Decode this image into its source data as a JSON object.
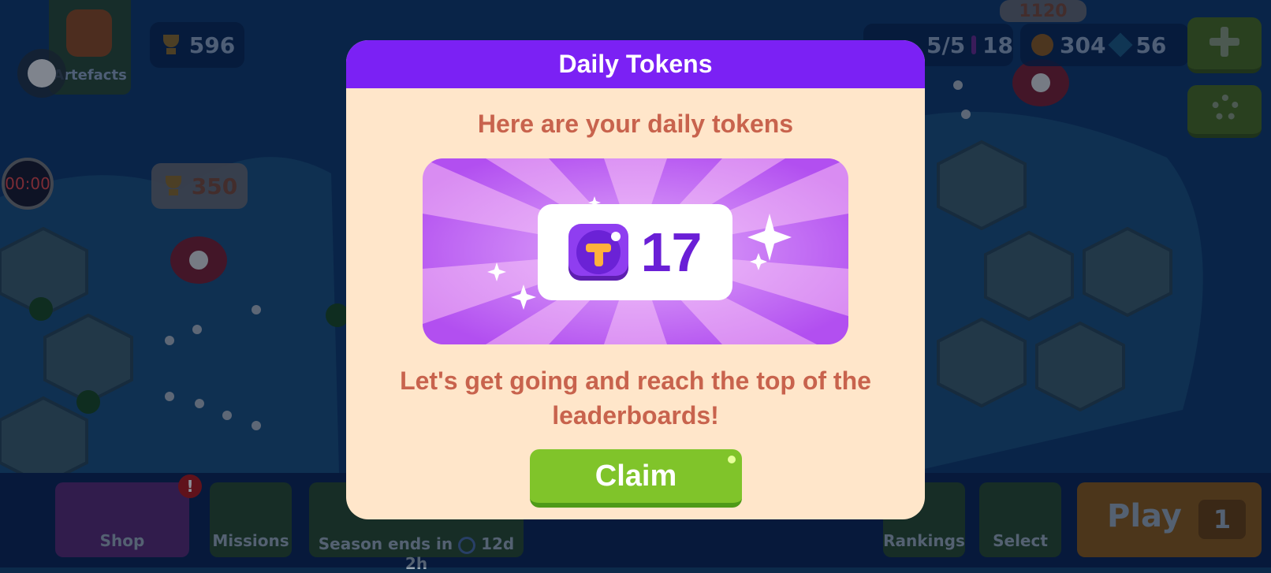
{
  "hud": {
    "artefacts_label": "Artefacts",
    "timer": "00:00",
    "trophies_main": "596",
    "trophies_marker": "350",
    "trophies_top": "1120",
    "lives": "5/5",
    "tokens_hud": "18",
    "coins": "304",
    "gems": "56"
  },
  "bottom_nav": {
    "shop": "Shop",
    "missions": "Missions",
    "season": "Season ends in",
    "season_time": "12d 2h",
    "rankings": "Rankings",
    "select": "Select",
    "play": "Play",
    "play_cost": "1"
  },
  "modal": {
    "title": "Daily Tokens",
    "subtitle": "Here are your daily tokens",
    "token_count": "17",
    "message": "Let's get going and reach the top of the leaderboards!",
    "claim_label": "Claim"
  },
  "colors": {
    "header": "#7b21f4",
    "panel": "#ffe6ca",
    "text": "#c8634d",
    "claim": "#80c42a",
    "token_count": "#6a1fd6"
  }
}
